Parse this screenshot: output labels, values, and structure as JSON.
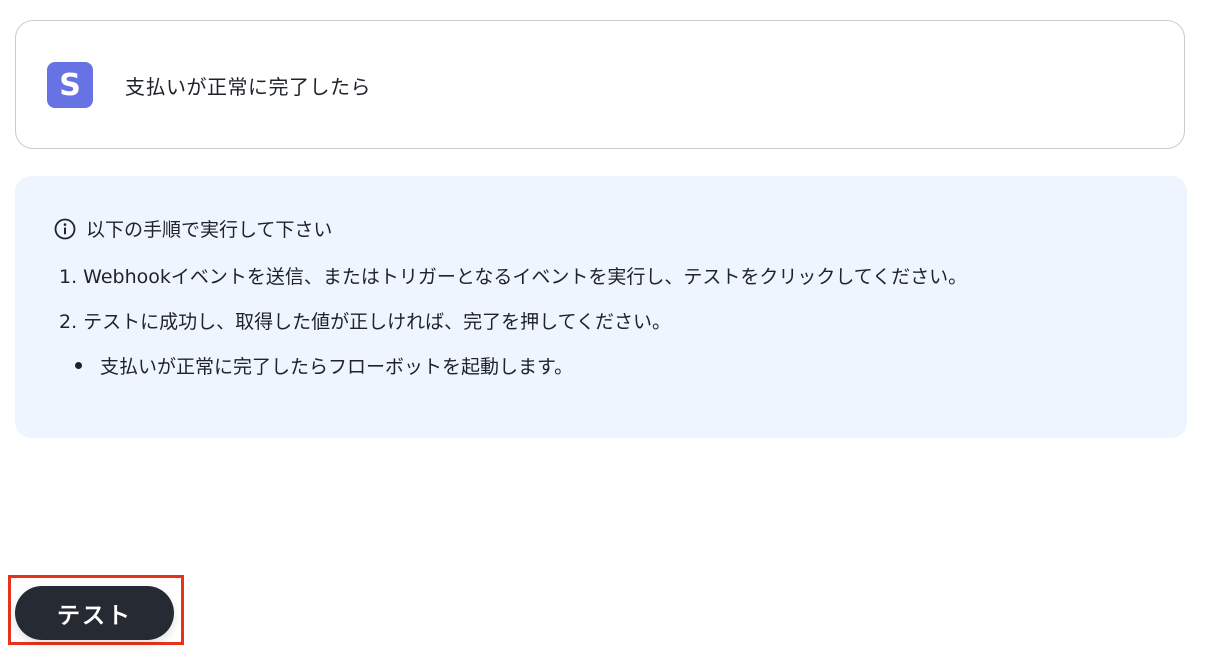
{
  "trigger": {
    "app_icon_letter": "S",
    "title": "支払いが正常に完了したら"
  },
  "info": {
    "heading": "以下の手順で実行して下さい",
    "steps": [
      "1. Webhookイベントを送信、またはトリガーとなるイベントを実行し、テストをクリックしてください。",
      "2. テストに成功し、取得した値が正しければ、完了を押してください。"
    ],
    "bullets": [
      "支払いが正常に完了したらフローボットを起動します。"
    ]
  },
  "actions": {
    "test_label": "テスト"
  },
  "colors": {
    "app_icon_bg": "#6772e5",
    "info_panel_bg": "#eef5fe",
    "button_bg": "#262a32",
    "highlight_border": "#e8331c"
  }
}
